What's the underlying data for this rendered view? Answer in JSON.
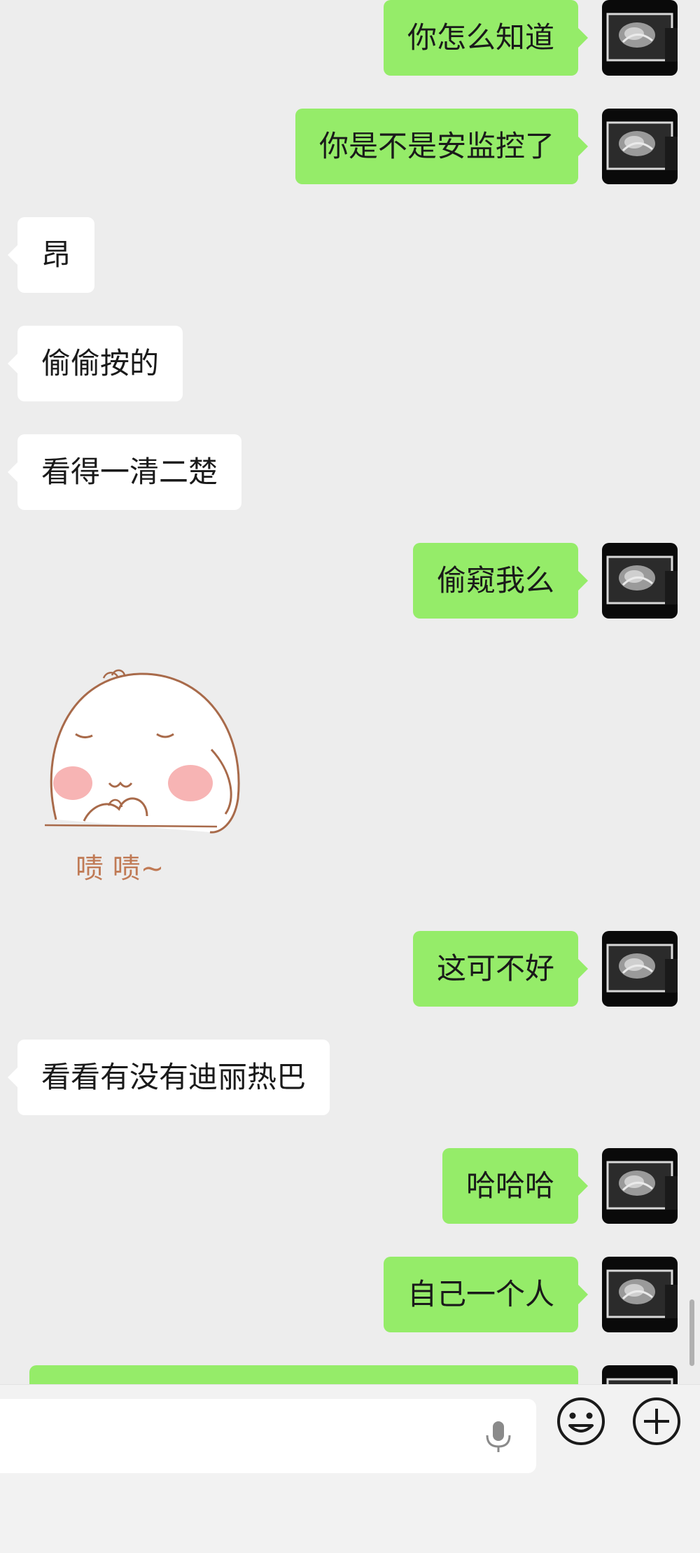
{
  "messages": [
    {
      "side": "right",
      "text": "你怎么知道"
    },
    {
      "side": "right",
      "text": "你是不是安监控了"
    },
    {
      "side": "left",
      "text": "昂"
    },
    {
      "side": "left",
      "text": "偷偷按的"
    },
    {
      "side": "left",
      "text": "看得一清二楚"
    },
    {
      "side": "right",
      "text": "偷窥我么"
    },
    {
      "side": "left",
      "type": "sticker",
      "caption": "啧 啧~"
    },
    {
      "side": "right",
      "text": "这可不好"
    },
    {
      "side": "left",
      "text": "看看有没有迪丽热巴"
    },
    {
      "side": "right",
      "text": "哈哈哈"
    },
    {
      "side": "right",
      "text": "自己一个人"
    }
  ],
  "input_bar": {
    "input_value": "",
    "icons": [
      "microphone-icon",
      "emoji-icon",
      "plus-icon"
    ]
  },
  "colors": {
    "background": "#ededed",
    "my_bubble": "#95ec69",
    "their_bubble": "#ffffff",
    "sticker_outline": "#a86a4a",
    "sticker_blush": "#f6a7a7"
  }
}
